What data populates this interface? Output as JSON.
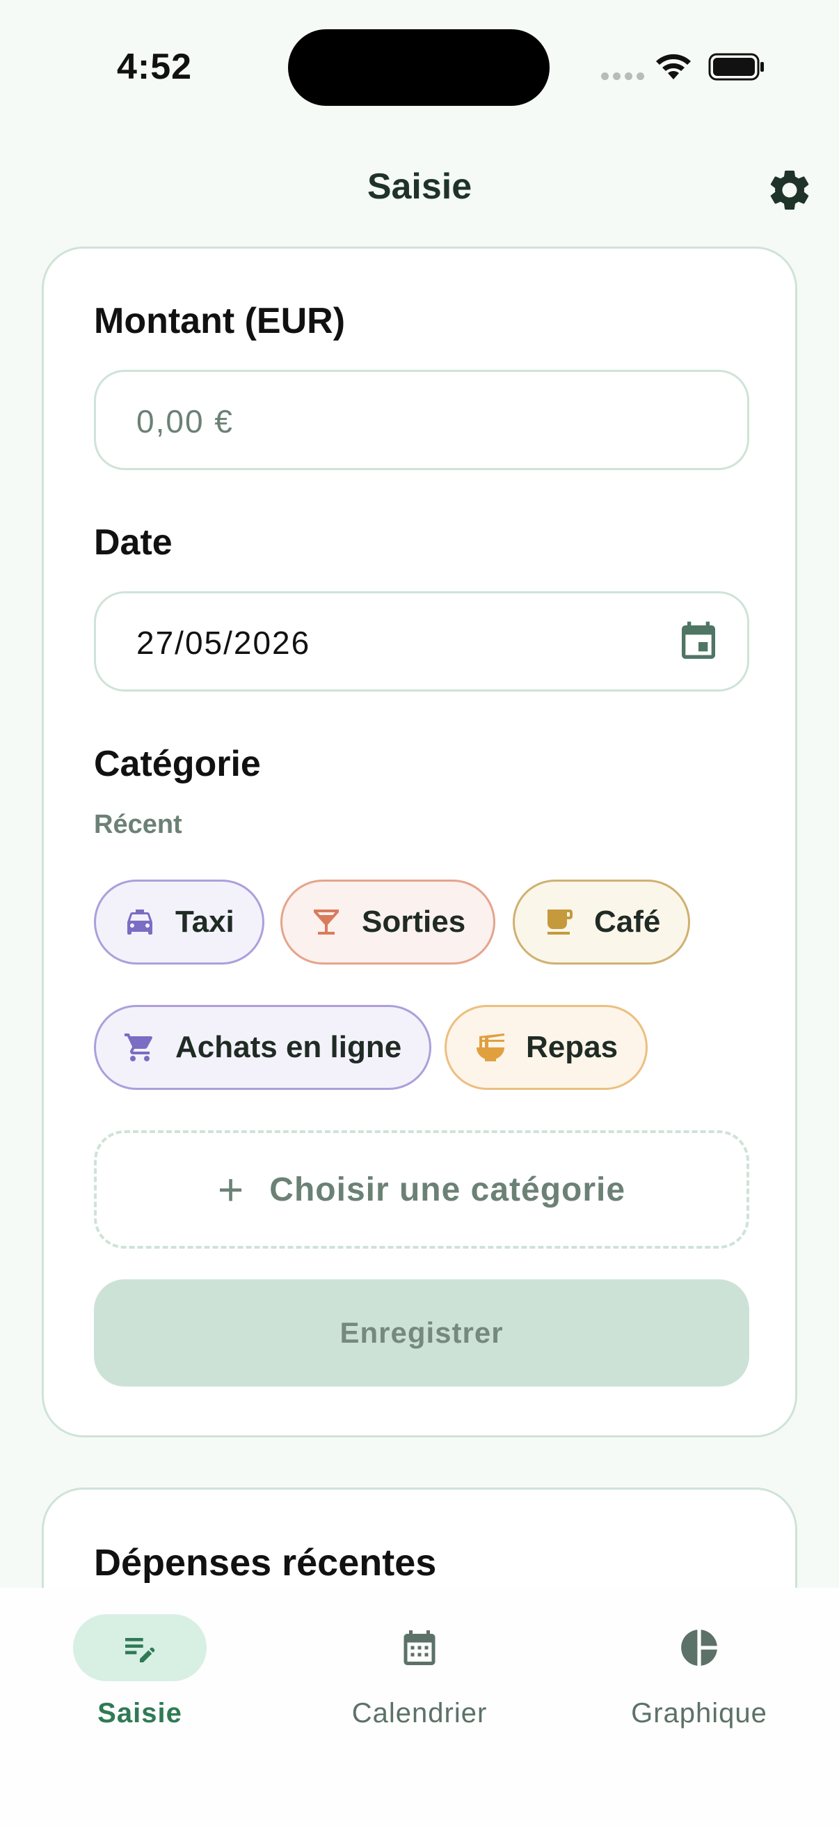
{
  "status_bar": {
    "time": "4:52"
  },
  "header": {
    "title": "Saisie"
  },
  "form": {
    "amount_label": "Montant (EUR)",
    "amount_placeholder": "0,00 €",
    "date_label": "Date",
    "date_value": "27/05/2026",
    "category_label": "Catégorie",
    "recent_label": "Récent",
    "recent_categories": [
      {
        "label": "Taxi",
        "icon": "taxi-icon",
        "color": "#7b6cc4"
      },
      {
        "label": "Sorties",
        "icon": "cocktail-icon",
        "color": "#d97b5c"
      },
      {
        "label": "Café",
        "icon": "coffee-icon",
        "color": "#c49a3c"
      },
      {
        "label": "Achats en ligne",
        "icon": "cart-icon",
        "color": "#7b6cc4"
      },
      {
        "label": "Repas",
        "icon": "noodle-bowl-icon",
        "color": "#e0a040"
      }
    ],
    "choose_category_label": "Choisir une catégorie",
    "save_label": "Enregistrer"
  },
  "recent_expenses": {
    "title": "Dépenses récentes"
  },
  "tab_bar": {
    "tabs": [
      {
        "label": "Saisie",
        "icon": "edit-list-icon",
        "active": true
      },
      {
        "label": "Calendrier",
        "icon": "calendar-icon",
        "active": false
      },
      {
        "label": "Graphique",
        "icon": "pie-chart-icon",
        "active": false
      }
    ]
  },
  "colors": {
    "accent": "#2f7a55",
    "background": "#f6faf7",
    "border": "#cfe3d7",
    "muted_text": "#6b8175"
  }
}
